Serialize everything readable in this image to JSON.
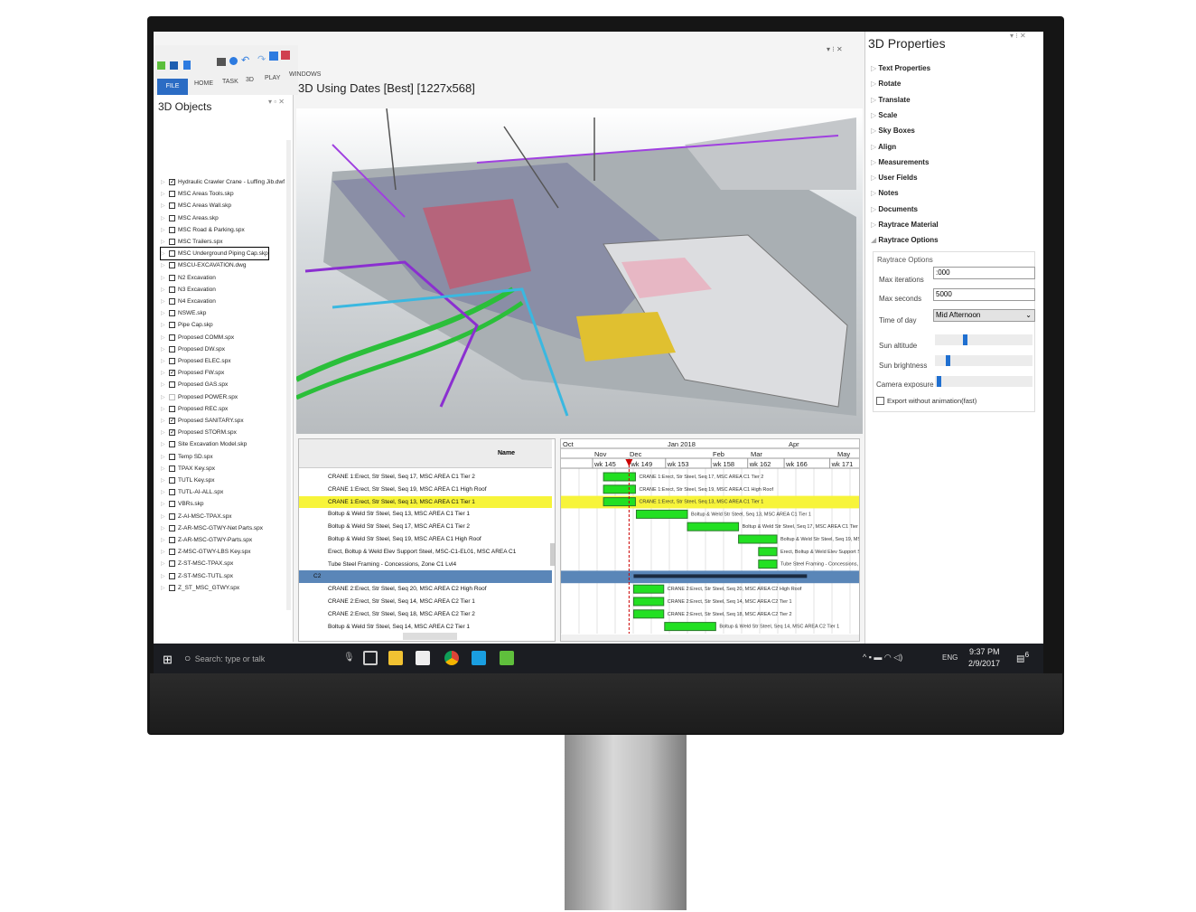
{
  "app": {
    "ribbon_tabs": [
      "FILE",
      "HOME",
      "TASK",
      "3D",
      "PLAY",
      "WINDOWS"
    ],
    "left_panel": {
      "title": "3D Objects",
      "items": [
        {
          "label": "Hydraulic Crawler Crane - Luffing Jib.dwf",
          "checked": true
        },
        {
          "label": "MSC Areas Tools.skp",
          "checked": false
        },
        {
          "label": "MSC Areas Wall.skp",
          "checked": false
        },
        {
          "label": "MSC Areas.skp",
          "checked": false
        },
        {
          "label": "MSC Road & Parking.spx",
          "checked": false
        },
        {
          "label": "MSC Trailers.spx",
          "checked": false
        },
        {
          "label": "MSC Underground Piping Cap.skp",
          "checked": false,
          "selected": true
        },
        {
          "label": "MSCU-EXCAVATION.dwg",
          "checked": false
        },
        {
          "label": "N2 Excavation",
          "checked": false
        },
        {
          "label": "N3 Excavation",
          "checked": false
        },
        {
          "label": "N4 Excavation",
          "checked": false
        },
        {
          "label": "NSWE.skp",
          "checked": false
        },
        {
          "label": "Pipe Cap.skp",
          "checked": false
        },
        {
          "label": "Proposed COMM.spx",
          "checked": false
        },
        {
          "label": "Proposed DW.spx",
          "checked": false
        },
        {
          "label": "Proposed ELEC.spx",
          "checked": false
        },
        {
          "label": "Proposed FW.spx",
          "checked": true
        },
        {
          "label": "Proposed GAS.spx",
          "checked": false
        },
        {
          "label": "Proposed POWER.spx",
          "checked": false,
          "disabled": true
        },
        {
          "label": "Proposed REC.spx",
          "checked": false
        },
        {
          "label": "Proposed SANITARY.spx",
          "checked": true
        },
        {
          "label": "Proposed STORM.spx",
          "checked": true
        },
        {
          "label": "Site Excavation Model.skp",
          "checked": false
        },
        {
          "label": "Temp SD.spx",
          "checked": false
        },
        {
          "label": "TPAX Key.spx",
          "checked": false
        },
        {
          "label": "TUTL Key.spx",
          "checked": false
        },
        {
          "label": "TUTL-AI-ALL.spx",
          "checked": false
        },
        {
          "label": "VBRs.skp",
          "checked": false
        },
        {
          "label": "Z-AI-MSC-TPAX.spx",
          "checked": false
        },
        {
          "label": "Z-AR-MSC-GTWY-Net Parts.spx",
          "checked": false
        },
        {
          "label": "Z-AR-MSC-GTWY-Parts.spx",
          "checked": false
        },
        {
          "label": "Z-MSC-GTWY-LBS Key.spx",
          "checked": false
        },
        {
          "label": "Z-ST-MSC-TPAX.spx",
          "checked": false
        },
        {
          "label": "Z-ST-MSC-TUTL.spx",
          "checked": false
        },
        {
          "label": "Z_ST_MSC_GTWY.spx",
          "checked": false
        }
      ]
    },
    "viewport": {
      "title": "3D Using Dates [Best] [1227x568]"
    },
    "grid": {
      "column_header": "Name",
      "rows": [
        {
          "name": "CRANE 1:Erect, Str Steel, Seq 17,  MSC AREA C1 Tier 2",
          "bar": [
            146,
            149.5
          ]
        },
        {
          "name": "CRANE 1:Erect, Str Steel, Seq 19,  MSC AREA C1 High Roof",
          "bar": [
            146,
            149.5
          ]
        },
        {
          "name": "CRANE 1:Erect, Str Steel, Seq 13,  MSC AREA C1 Tier 1",
          "bar": [
            146,
            149.5
          ],
          "highlight": true
        },
        {
          "name": "Boltup & Weld Str Steel, Seq 13, MSC AREA C1 Tier 1",
          "bar": [
            149.6,
            155.2
          ]
        },
        {
          "name": "Boltup & Weld Str Steel, Seq 17, MSC AREA C1 Tier 2",
          "bar": [
            155.2,
            160.8
          ]
        },
        {
          "name": "Boltup & Weld Str Steel, Seq 19, MSC AREA C1 High Roof",
          "bar": [
            160.8,
            165
          ]
        },
        {
          "name": "Erect, Boltup & Weld Elev Support Steel, MSC-C1-EL01, MSC AREA C1",
          "bar": [
            163,
            165
          ]
        },
        {
          "name": "Tube Steel Framing - Concessions, Zone C1 Lvl4",
          "bar": [
            163,
            165
          ]
        },
        {
          "name": "C2",
          "group": true,
          "bar": [
            149.3,
            168.3
          ]
        },
        {
          "name": "CRANE 2:Erect, Str Steel, Seq 20,  MSC AREA C2 High Roof",
          "bar": [
            149.3,
            152.6
          ]
        },
        {
          "name": "CRANE 2:Erect, Str Steel, Seq 14,  MSC AREA C2 Tier 1",
          "bar": [
            149.3,
            152.6
          ]
        },
        {
          "name": "CRANE 2:Erect, Str Steel, Seq 18,  MSC AREA C2 Tier 2",
          "bar": [
            149.3,
            152.6
          ]
        },
        {
          "name": "Boltup & Weld Str Steel, Seq 14, MSC AREA C2 Tier 1",
          "bar": [
            152.7,
            158.3
          ]
        }
      ]
    },
    "gantt": {
      "months_top": [
        "Oct",
        "Jan 2018",
        "Apr"
      ],
      "months": [
        "Nov",
        "Dec",
        "Feb",
        "Mar",
        "May"
      ],
      "weeks": [
        {
          "label": "wk 145",
          "wk": 145
        },
        {
          "label": "wk 149",
          "wk": 149
        },
        {
          "label": "wk 153",
          "wk": 153
        },
        {
          "label": "wk 158",
          "wk": 158
        },
        {
          "label": "wk 162",
          "wk": 162
        },
        {
          "label": "wk 166",
          "wk": 166
        },
        {
          "label": "wk 171",
          "wk": 171
        }
      ],
      "today_wk": 148.8,
      "bar_color": "#22e022",
      "highlight_color": "#f7f43a",
      "group_color": "#5a86b8"
    },
    "properties": {
      "title": "3D Properties",
      "sections": [
        "Text Properties",
        "Rotate",
        "Translate",
        "Scale",
        "Sky Boxes",
        "Align",
        "Measurements",
        "User Fields",
        "Notes",
        "Documents",
        "Raytrace Material",
        "Raytrace Options"
      ],
      "raytrace": {
        "group": "Raytrace Options",
        "max_iterations_label": "Max iterations",
        "max_iterations": ":000",
        "max_seconds_label": "Max seconds",
        "max_seconds": "5000",
        "time_of_day_label": "Time of day",
        "time_of_day": "Mid Afternoon",
        "sun_altitude_label": "Sun altitude",
        "sun_altitude": 0.3,
        "sun_brightness_label": "Sun brightness",
        "sun_brightness": 0.12,
        "camera_exposure_label": "Camera exposure",
        "camera_exposure": 0.02,
        "export_label": "Export without animation(fast)",
        "export_checked": false
      }
    }
  },
  "taskbar": {
    "search_placeholder": "Search: type or talk",
    "lang": "ENG",
    "time": "9:37 PM",
    "date": "2/9/2017",
    "notifications": "6"
  }
}
